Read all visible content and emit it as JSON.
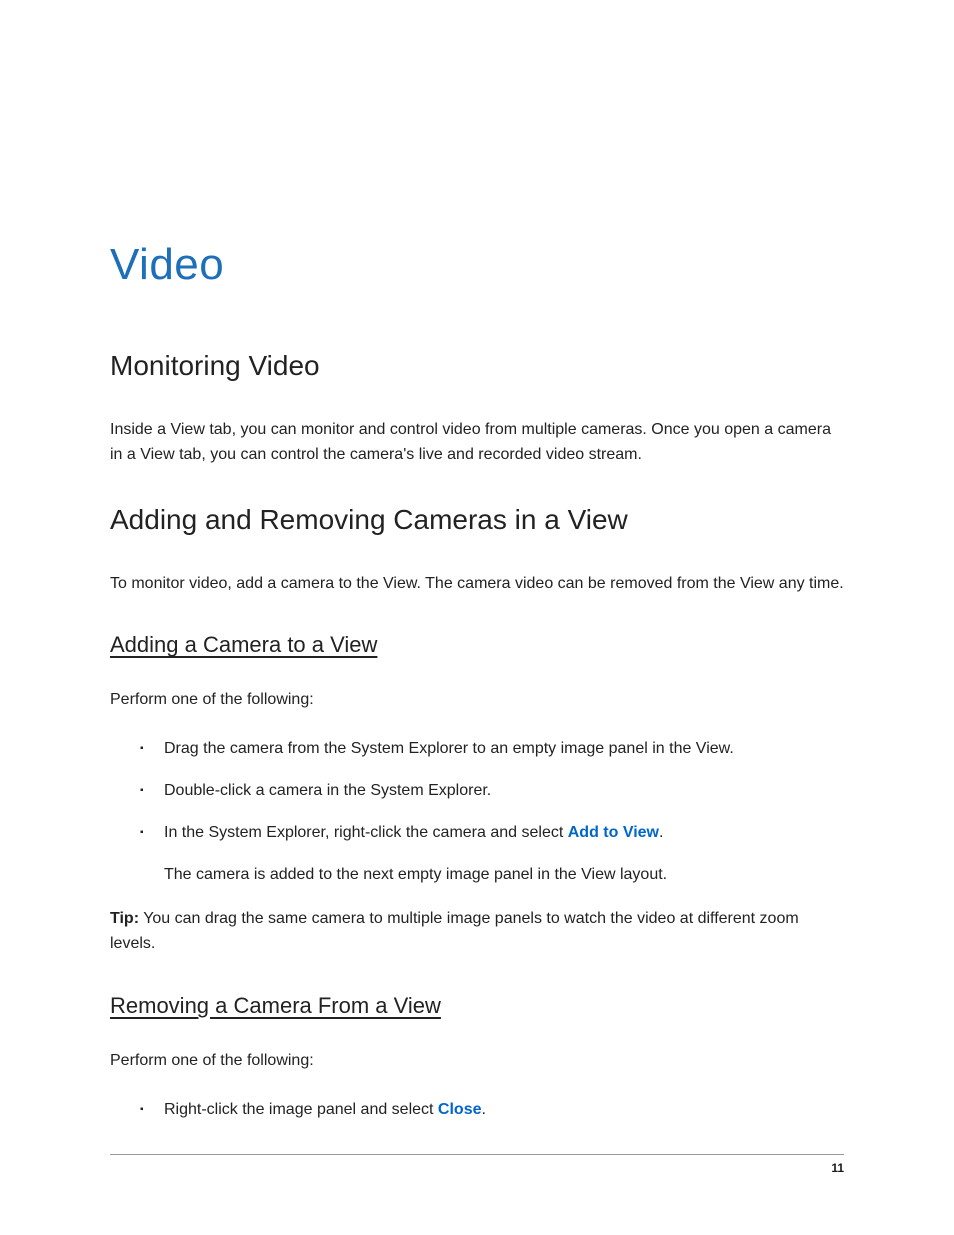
{
  "title": "Video",
  "section1": {
    "heading": "Monitoring Video",
    "para": "Inside a View tab, you can monitor and control video from multiple cameras. Once you open a camera in a View tab, you can control the camera's live and recorded video stream."
  },
  "section2": {
    "heading": "Adding and Removing Cameras in a View",
    "para": "To monitor video, add a camera to the View. The camera video can be removed from the View any time."
  },
  "subsection_add": {
    "heading": "Adding a Camera to a View",
    "intro": "Perform one of the following:",
    "bullets": {
      "b1": "Drag the camera from the System Explorer to an empty image panel in the View.",
      "b2": "Double-click a camera in the System Explorer.",
      "b3_prefix": "In the System Explorer, right-click the camera and select ",
      "b3_action": "Add to View",
      "b3_suffix": ".",
      "b3_result": "The camera is added to the next empty image panel in the View layout."
    },
    "tip_label": "Tip:",
    "tip_text": "   You can drag the same camera to multiple image panels to watch the video at different zoom levels."
  },
  "subsection_remove": {
    "heading": "Removing a Camera From a View",
    "intro": "Perform one of the following:",
    "bullets": {
      "b1_prefix": "Right-click the image panel and select ",
      "b1_action": "Close",
      "b1_suffix": "."
    }
  },
  "page_number": "11"
}
